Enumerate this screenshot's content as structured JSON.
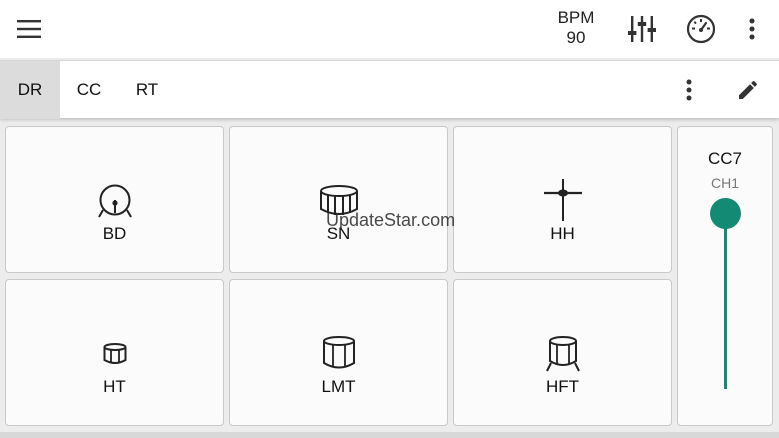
{
  "appbar": {
    "bpm_label": "BPM",
    "bpm_value": "90",
    "icons": [
      "menu-icon",
      "equalizer-icon",
      "gauge-icon",
      "more-vert-icon"
    ]
  },
  "tabs": [
    {
      "label": "DR",
      "active": true
    },
    {
      "label": "CC",
      "active": false
    },
    {
      "label": "RT",
      "active": false
    }
  ],
  "tabbar_icons": [
    "more-vert-icon",
    "pencil-icon"
  ],
  "pads": [
    {
      "label": "BD",
      "icon": "bass-drum-icon"
    },
    {
      "label": "SN",
      "icon": "snare-drum-icon"
    },
    {
      "label": "HH",
      "icon": "hi-hat-icon"
    },
    {
      "label": "HT",
      "icon": "high-tom-icon"
    },
    {
      "label": "LMT",
      "icon": "low-mid-tom-icon"
    },
    {
      "label": "HFT",
      "icon": "high-floor-tom-icon"
    }
  ],
  "slider": {
    "cc": "CC7",
    "channel": "CH1",
    "level": 1.0,
    "accent_color": "#138a74"
  },
  "watermark": "UpdateStar.com"
}
